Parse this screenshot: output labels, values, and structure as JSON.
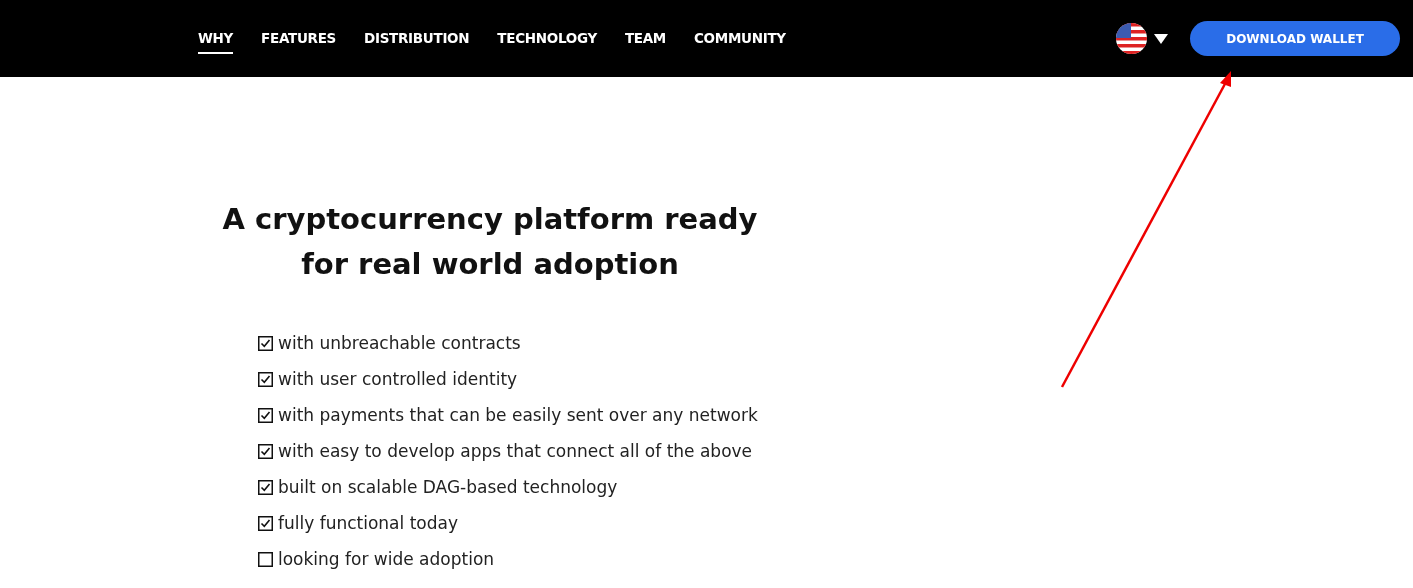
{
  "nav": {
    "items": [
      {
        "label": "WHY",
        "selected": true
      },
      {
        "label": "FEATURES",
        "selected": false
      },
      {
        "label": "DISTRIBUTION",
        "selected": false
      },
      {
        "label": "TECHNOLOGY",
        "selected": false
      },
      {
        "label": "TEAM",
        "selected": false
      },
      {
        "label": "COMMUNITY",
        "selected": false
      }
    ],
    "download_button": "DOWNLOAD WALLET"
  },
  "hero": {
    "title": "A cryptocurrency platform ready for real world adoption",
    "checklist": [
      {
        "text": "with unbreachable contracts",
        "checked": true
      },
      {
        "text": "with user controlled identity",
        "checked": true
      },
      {
        "text": "with payments that can be easily sent over any network",
        "checked": true
      },
      {
        "text": "with easy to develop apps that connect all of the above",
        "checked": true
      },
      {
        "text": "built on scalable DAG-based technology",
        "checked": true
      },
      {
        "text": "fully functional today",
        "checked": true
      },
      {
        "text": "looking for wide adoption",
        "checked": false
      }
    ]
  }
}
